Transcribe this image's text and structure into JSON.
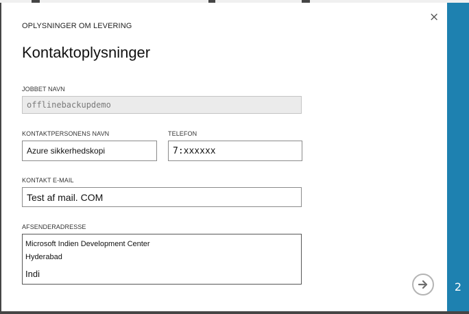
{
  "dialog": {
    "section_header": "OPLYSNINGER OM LEVERING",
    "title": "Kontaktoplysninger",
    "close_glyph": "×"
  },
  "form": {
    "job_name": {
      "label": "JOBBET NAVN",
      "value": "offlinebackupdemo"
    },
    "contact_person": {
      "label": "KONTAKTPERSONENS NAVN",
      "value": "Azure sikkerhedskopi"
    },
    "phone": {
      "label": "TELEFON",
      "value": "7:xxxxxx"
    },
    "email": {
      "label": "KONTAKT E-MAIL",
      "value": "Test af mail. COM"
    },
    "sender_address": {
      "label": "AFSENDERADRESSE",
      "lines": [
        "Microsoft Indien Development Center",
        "Hyderabad",
        "Indi"
      ]
    }
  },
  "navigation": {
    "next_icon": "arrow-right-icon",
    "step": "2"
  },
  "colors": {
    "side_panel": "#1e81b0",
    "backdrop": "#454545"
  }
}
